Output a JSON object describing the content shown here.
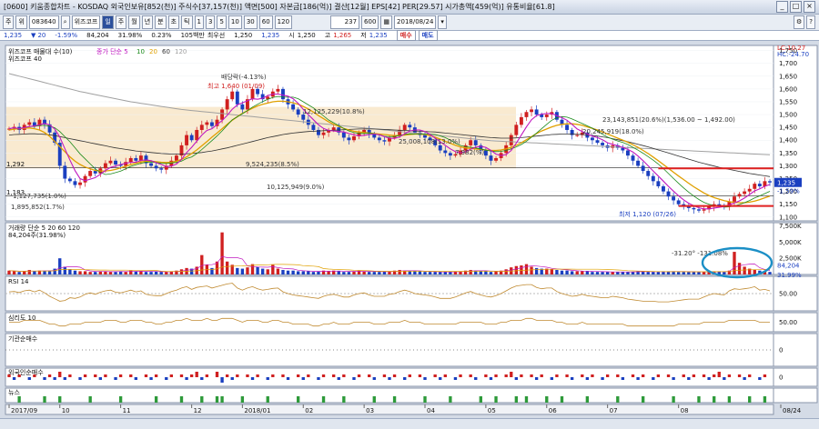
{
  "window": {
    "title": "[0600] 키움종합차트 - KOSDAQ 외국인보유[852(천)] 주식수[37,157(천)] 액면[500] 자본금[186(억)] 결산[12월] EPS[42] PER[29.57] 시가총액[459(억)] 유통비율[61.8]"
  },
  "toolbar": {
    "left_buttons": [
      "주",
      "위"
    ],
    "code_field": "083640",
    "name_field": "위즈코프",
    "period_buttons": [
      "일",
      "주",
      "월",
      "년",
      "분",
      "초",
      "틱"
    ],
    "interval_buttons": [
      "1",
      "3",
      "5",
      "10",
      "30",
      "60",
      "120"
    ],
    "count_field": "237",
    "count_total": "600",
    "date_field": "2018/08/24"
  },
  "quote": {
    "price": "1,235",
    "change": "20",
    "change_rate": "-1.59%",
    "volume": "84,204",
    "volume_ratio": "31.98%",
    "turnover": "0.23%",
    "basis": "105백만",
    "min_label": "최우선",
    "best_bid": "1,250",
    "best_ask": "1,235",
    "open_label": "시",
    "open": "1,250",
    "high_label": "고",
    "high": "1,265",
    "low_label": "저",
    "low": "1,235",
    "buy_button": "매수",
    "sell_button": "매도"
  },
  "chart_data": {
    "type": "line",
    "price_legend": [
      "위즈코프 매물대 수(10)",
      "종가 단순 5",
      "10",
      "20",
      "60",
      "120"
    ],
    "price_header": "위즈코프 40",
    "y_ticks": [
      "1,750",
      "1,700",
      "1,650",
      "1,600",
      "1,550",
      "1,500",
      "1,450",
      "1,400",
      "1,350",
      "1,300",
      "1,250",
      "1,200",
      "1,150",
      "1,100"
    ],
    "ylim": [
      1085,
      1770
    ],
    "lc_label": "LC:10.27",
    "hc_label": "HC:-24.70",
    "last_price_label": "1,235",
    "last_change_label": "-1.59%",
    "ref_lines": [
      {
        "label": "1,292",
        "value": 1292
      },
      {
        "label": "1,183",
        "value": 1183
      }
    ],
    "annotations": [
      "배당락(-4.13%)",
      "최고 1,640 (01/09)",
      "12,125,229(10.8%)",
      "9,524,235(8.5%)",
      "10,125,949(9.0%)",
      "1,127,735(1.0%)",
      "1,895,852(1.7%)",
      "25,008,108(13.0%)",
      "7,982(%)",
      "20,245,919(18.0%)",
      "23,143,851(20.6%)(1,536.00 ~ 1,492.00)",
      "최저 1,120 (07/26)"
    ],
    "volume_legend": "거래량 단순 5 20 60 120",
    "volume_value": "84,204주(31.98%)",
    "volume_annotation": "-31.20° -131.08%",
    "volume_ticks": [
      "7,500K",
      "5,000K",
      "2,500K"
    ],
    "volume_last_label": "84,204",
    "volume_last_pct": "31.99%",
    "rsi_legend": "RSI 14",
    "rsi_tick": "50.00",
    "psy_legend": "심리도 10",
    "psy_tick": "50.00",
    "inst_legend": "기관순매수",
    "inst_tick": "0",
    "foreign_legend": "외국인순매수",
    "foreign_tick": "0",
    "news_legend": "뉴스",
    "x_labels": [
      "2017/09",
      "10",
      "11",
      "12",
      "2018/01",
      "02",
      "03",
      "04",
      "05",
      "06",
      "07",
      "08",
      "08/24"
    ],
    "close": [
      1445,
      1452,
      1440,
      1460,
      1470,
      1455,
      1480,
      1462,
      1430,
      1390,
      1300,
      1250,
      1240,
      1225,
      1235,
      1260,
      1280,
      1270,
      1290,
      1310,
      1320,
      1305,
      1300,
      1315,
      1330,
      1320,
      1340,
      1310,
      1300,
      1290,
      1285,
      1300,
      1320,
      1340,
      1380,
      1420,
      1400,
      1440,
      1460,
      1470,
      1455,
      1480,
      1520,
      1560,
      1590,
      1540,
      1520,
      1560,
      1600,
      1580,
      1560,
      1570,
      1590,
      1600,
      1560,
      1540,
      1520,
      1500,
      1480,
      1460,
      1440,
      1420,
      1430,
      1440,
      1450,
      1430,
      1410,
      1400,
      1415,
      1430,
      1440,
      1425,
      1410,
      1400,
      1395,
      1410,
      1420,
      1440,
      1460,
      1450,
      1430,
      1420,
      1410,
      1400,
      1380,
      1360,
      1350,
      1340,
      1345,
      1360,
      1380,
      1400,
      1380,
      1360,
      1340,
      1320,
      1330,
      1350,
      1380,
      1420,
      1460,
      1490,
      1510,
      1520,
      1500,
      1490,
      1500,
      1510,
      1480,
      1460,
      1440,
      1420,
      1420,
      1430,
      1410,
      1400,
      1390,
      1380,
      1370,
      1380,
      1370,
      1360,
      1340,
      1320,
      1300,
      1280,
      1260,
      1240,
      1220,
      1200,
      1180,
      1165,
      1150,
      1140,
      1135,
      1130,
      1125,
      1130,
      1140,
      1150,
      1145,
      1140,
      1160,
      1180,
      1190,
      1200,
      1210,
      1230,
      1220,
      1240,
      1235
    ],
    "ma20": [
      1440,
      1443,
      1445,
      1447,
      1448,
      1445,
      1440,
      1430,
      1415,
      1395,
      1375,
      1355,
      1335,
      1318,
      1305,
      1295,
      1288,
      1282,
      1280,
      1280,
      1282,
      1286,
      1292,
      1298,
      1305,
      1310,
      1315,
      1318,
      1318,
      1316,
      1314,
      1313,
      1314,
      1318,
      1325,
      1335,
      1348,
      1362,
      1378,
      1395,
      1412,
      1428,
      1445,
      1462,
      1478,
      1492,
      1505,
      1515,
      1525,
      1534,
      1540,
      1545,
      1550,
      1552,
      1552,
      1550,
      1546,
      1540,
      1532,
      1522,
      1510,
      1496,
      1484,
      1472,
      1462,
      1454,
      1446,
      1440,
      1435,
      1432,
      1430,
      1428,
      1426,
      1424,
      1422,
      1420,
      1418,
      1418,
      1420,
      1422,
      1424,
      1424,
      1422,
      1418,
      1412,
      1404,
      1396,
      1388,
      1380,
      1374,
      1370,
      1368,
      1366,
      1364,
      1362,
      1360,
      1360,
      1362,
      1366,
      1372,
      1380,
      1390,
      1402,
      1414,
      1426,
      1436,
      1444,
      1452,
      1458,
      1462,
      1464,
      1464,
      1462,
      1458,
      1452,
      1446,
      1440,
      1432,
      1424,
      1416,
      1408,
      1400,
      1392,
      1382,
      1372,
      1360,
      1348,
      1334,
      1320,
      1305,
      1290,
      1275,
      1260,
      1246,
      1232,
      1218,
      1206,
      1194,
      1184,
      1176,
      1170,
      1164,
      1160,
      1157,
      1156,
      1156,
      1158,
      1162,
      1168,
      1175,
      1182
    ],
    "ma60": [
      1420,
      1422,
      1423,
      1424,
      1425,
      1425,
      1424,
      1423,
      1421,
      1418,
      1414,
      1410,
      1406,
      1402,
      1398,
      1394,
      1390,
      1386,
      1382,
      1378,
      1374,
      1370,
      1367,
      1364,
      1361,
      1358,
      1356,
      1354,
      1352,
      1350,
      1348,
      1347,
      1346,
      1346,
      1346,
      1347,
      1348,
      1350,
      1352,
      1355,
      1358,
      1362,
      1366,
      1370,
      1375,
      1380,
      1385,
      1390,
      1395,
      1400,
      1405,
      1410,
      1414,
      1418,
      1422,
      1425,
      1428,
      1430,
      1432,
      1434,
      1435,
      1436,
      1437,
      1438,
      1439,
      1440,
      1441,
      1442,
      1443,
      1444,
      1444,
      1444,
      1444,
      1443,
      1442,
      1441,
      1440,
      1439,
      1438,
      1437,
      1436,
      1435,
      1434,
      1433,
      1432,
      1430,
      1428,
      1426,
      1424,
      1422,
      1420,
      1418,
      1416,
      1414,
      1412,
      1410,
      1409,
      1408,
      1408,
      1408,
      1409,
      1410,
      1412,
      1414,
      1416,
      1418,
      1420,
      1422,
      1423,
      1424,
      1424,
      1424,
      1423,
      1422,
      1420,
      1418,
      1416,
      1413,
      1410,
      1406,
      1402,
      1398,
      1394,
      1389,
      1384,
      1379,
      1374,
      1368,
      1362,
      1356,
      1350,
      1344,
      1338,
      1332,
      1326,
      1320,
      1314,
      1309,
      1304,
      1299,
      1294,
      1290,
      1286,
      1282,
      1278,
      1274,
      1270,
      1267,
      1264,
      1261,
      1258
    ],
    "ma120": [
      1660,
      1655,
      1650,
      1645,
      1640,
      1635,
      1630,
      1625,
      1620,
      1615,
      1610,
      1605,
      1600,
      1595,
      1590,
      1586,
      1582,
      1578,
      1574,
      1570,
      1566,
      1562,
      1558,
      1554,
      1550,
      1547,
      1544,
      1541,
      1538,
      1535,
      1532,
      1529,
      1526,
      1523,
      1520,
      1518,
      1516,
      1514,
      1512,
      1510,
      1508,
      1506,
      1504,
      1502,
      1500,
      1498,
      1496,
      1494,
      1492,
      1490,
      1488,
      1486,
      1484,
      1482,
      1480,
      1478,
      1476,
      1474,
      1472,
      1470,
      1468,
      1466,
      1464,
      1462,
      1460,
      1458,
      1456,
      1454,
      1452,
      1450,
      1448,
      1446,
      1444,
      1442,
      1440,
      1438,
      1436,
      1434,
      1432,
      1430,
      1428,
      1426,
      1424,
      1422,
      1420,
      1418,
      1416,
      1414,
      1412,
      1410,
      1408,
      1406,
      1404,
      1402,
      1400,
      1398,
      1397,
      1396,
      1395,
      1394,
      1393,
      1392,
      1391,
      1390,
      1389,
      1388,
      1387,
      1386,
      1385,
      1384,
      1383,
      1382,
      1381,
      1380,
      1379,
      1378,
      1377,
      1376,
      1375,
      1374,
      1373,
      1372,
      1371,
      1370,
      1369,
      1368,
      1367,
      1366,
      1365,
      1364,
      1363,
      1362,
      1361,
      1360,
      1359,
      1358,
      1357,
      1356,
      1355,
      1354,
      1353,
      1352,
      1351,
      1350,
      1349,
      1348,
      1347,
      1346,
      1345,
      1344,
      1343
    ],
    "volume": [
      0.6,
      0.5,
      0.4,
      0.5,
      0.7,
      0.5,
      0.6,
      0.5,
      0.6,
      0.9,
      2.5,
      1.2,
      0.8,
      0.6,
      0.5,
      0.5,
      0.4,
      0.4,
      0.5,
      0.5,
      0.4,
      0.4,
      0.5,
      0.4,
      0.6,
      0.5,
      0.5,
      0.4,
      0.4,
      0.5,
      0.4,
      0.4,
      0.5,
      0.6,
      0.8,
      1.0,
      0.9,
      1.2,
      3.0,
      1.5,
      1.0,
      2.0,
      6.5,
      2.0,
      1.5,
      1.0,
      0.9,
      1.1,
      1.6,
      1.2,
      0.9,
      0.8,
      1.5,
      0.9,
      0.7,
      0.6,
      0.6,
      0.5,
      0.5,
      0.5,
      0.4,
      0.5,
      0.6,
      0.5,
      0.6,
      0.5,
      0.4,
      0.4,
      0.5,
      0.6,
      0.5,
      0.4,
      0.4,
      0.4,
      0.5,
      0.5,
      0.6,
      0.7,
      0.6,
      0.5,
      0.5,
      0.5,
      0.4,
      0.4,
      0.4,
      0.4,
      0.4,
      0.4,
      0.5,
      0.5,
      0.6,
      0.7,
      0.6,
      0.5,
      0.5,
      0.4,
      0.5,
      0.6,
      0.8,
      1.1,
      1.3,
      1.4,
      1.6,
      1.2,
      1.0,
      0.9,
      0.9,
      0.8,
      0.7,
      0.6,
      0.6,
      0.5,
      0.5,
      0.5,
      0.5,
      0.4,
      0.4,
      0.4,
      0.4,
      0.4,
      0.4,
      0.4,
      0.4,
      0.4,
      0.5,
      0.5,
      0.4,
      0.4,
      0.4,
      0.5,
      0.5,
      0.5,
      0.4,
      0.4,
      0.4,
      0.4,
      0.4,
      0.4,
      0.4,
      0.5,
      0.5,
      0.4,
      0.6,
      3.5,
      1.8,
      1.2,
      0.9,
      0.7,
      0.6,
      0.5,
      0.4
    ],
    "rsi": [
      55,
      56,
      53,
      58,
      60,
      55,
      60,
      52,
      42,
      35,
      28,
      30,
      38,
      36,
      40,
      48,
      52,
      48,
      54,
      58,
      60,
      54,
      52,
      56,
      60,
      55,
      58,
      48,
      45,
      44,
      44,
      50,
      56,
      60,
      66,
      70,
      62,
      68,
      70,
      72,
      66,
      70,
      74,
      78,
      80,
      66,
      60,
      66,
      70,
      64,
      60,
      62,
      65,
      66,
      55,
      50,
      46,
      44,
      42,
      40,
      38,
      36,
      42,
      46,
      48,
      44,
      40,
      40,
      46,
      50,
      52,
      46,
      42,
      42,
      42,
      48,
      50,
      56,
      60,
      56,
      50,
      48,
      46,
      44,
      40,
      36,
      36,
      36,
      40,
      46,
      52,
      56,
      50,
      46,
      42,
      40,
      44,
      50,
      58,
      66,
      72,
      74,
      76,
      76,
      68,
      64,
      66,
      66,
      56,
      50,
      46,
      42,
      44,
      48,
      44,
      42,
      40,
      38,
      38,
      42,
      40,
      38,
      34,
      32,
      30,
      28,
      28,
      28,
      26,
      26,
      26,
      28,
      30,
      32,
      34,
      34,
      34,
      40,
      46,
      50,
      48,
      46,
      58,
      64,
      62,
      64,
      66,
      70,
      60,
      62,
      58
    ],
    "psy": [
      50,
      50,
      50,
      60,
      60,
      60,
      60,
      50,
      40,
      40,
      30,
      30,
      40,
      40,
      40,
      50,
      50,
      50,
      50,
      60,
      60,
      60,
      50,
      50,
      60,
      60,
      60,
      50,
      50,
      40,
      40,
      50,
      50,
      60,
      60,
      70,
      60,
      60,
      60,
      70,
      60,
      60,
      70,
      70,
      70,
      60,
      50,
      60,
      60,
      60,
      50,
      50,
      60,
      60,
      50,
      50,
      40,
      40,
      40,
      40,
      30,
      30,
      40,
      40,
      50,
      40,
      40,
      40,
      50,
      50,
      50,
      50,
      40,
      40,
      40,
      50,
      50,
      50,
      60,
      50,
      50,
      50,
      40,
      40,
      40,
      40,
      40,
      40,
      40,
      50,
      50,
      50,
      50,
      50,
      40,
      40,
      40,
      50,
      50,
      60,
      60,
      60,
      70,
      70,
      60,
      60,
      60,
      60,
      50,
      50,
      40,
      40,
      40,
      50,
      40,
      40,
      40,
      40,
      40,
      40,
      40,
      40,
      30,
      30,
      30,
      30,
      30,
      30,
      30,
      30,
      30,
      30,
      40,
      40,
      40,
      40,
      40,
      50,
      50,
      50,
      50,
      50,
      60,
      60,
      60,
      60,
      60,
      60,
      50,
      50,
      50
    ],
    "inst": [
      0,
      0,
      0,
      0,
      0,
      0,
      0,
      0,
      0,
      0,
      0,
      0,
      0,
      0,
      0,
      0,
      0,
      0,
      0,
      0,
      0,
      0,
      0,
      0,
      0,
      0,
      0,
      0,
      0,
      0,
      0,
      0,
      0,
      0,
      0,
      0,
      0,
      0,
      0,
      0,
      0,
      0,
      0,
      0,
      0,
      0,
      0,
      0,
      0,
      0,
      0,
      0,
      0,
      0,
      0,
      0,
      0,
      0,
      0,
      0,
      0,
      0,
      0,
      0,
      0,
      0,
      0,
      0,
      0,
      0,
      0,
      0,
      0,
      0,
      0,
      0,
      0,
      0,
      0,
      0,
      0,
      0,
      0,
      0,
      0,
      0,
      0,
      0,
      0,
      0,
      0,
      0,
      0,
      0,
      0,
      0,
      0,
      0,
      0,
      0,
      0,
      0,
      0,
      0,
      0,
      0,
      0,
      0,
      0,
      0,
      0,
      0,
      0,
      0,
      0,
      0,
      0,
      0,
      0,
      0,
      0,
      0,
      0,
      0,
      0,
      0,
      0,
      0,
      0,
      0,
      0,
      0,
      0,
      0,
      0,
      0,
      0,
      0,
      0,
      0,
      0,
      0,
      0,
      0,
      0,
      0,
      0,
      0,
      0,
      0,
      0
    ],
    "foreign": [
      1,
      -1,
      1,
      0,
      -1,
      1,
      0,
      -1,
      1,
      -1,
      2,
      -1,
      1,
      0,
      -1,
      1,
      0,
      1,
      -1,
      1,
      0,
      -1,
      1,
      0,
      1,
      -1,
      0,
      1,
      -1,
      1,
      0,
      -1,
      1,
      0,
      1,
      -1,
      1,
      2,
      -1,
      1,
      0,
      2,
      -2,
      1,
      -1,
      1,
      0,
      1,
      -1,
      1,
      0,
      -1,
      1,
      0,
      1,
      -1,
      0,
      1,
      -1,
      1,
      0,
      -1,
      1,
      0,
      1,
      -1,
      1,
      0,
      -1,
      1,
      0,
      1,
      -1,
      0,
      1,
      -1,
      1,
      0,
      -1,
      1,
      0,
      1,
      -1,
      0,
      1,
      -1,
      1,
      0,
      -1,
      1,
      0,
      1,
      -1,
      0,
      1,
      -1,
      1,
      0,
      1,
      2,
      -1,
      1,
      0,
      1,
      -1,
      1,
      0,
      -1,
      1,
      0,
      1,
      -1,
      0,
      1,
      -1,
      1,
      0,
      -1,
      1,
      0,
      1,
      -1,
      0,
      1,
      -1,
      1,
      0,
      -1,
      1,
      0,
      1,
      -1,
      0,
      1,
      -1,
      1,
      0,
      1,
      -1,
      1,
      2,
      -1,
      1,
      0,
      1,
      -1,
      1,
      0,
      -1,
      1
    ],
    "news": [
      0,
      0,
      1,
      0,
      0,
      0,
      0,
      1,
      0,
      0,
      1,
      0,
      0,
      0,
      0,
      0,
      1,
      0,
      0,
      0,
      0,
      0,
      1,
      0,
      0,
      0,
      0,
      0,
      0,
      1,
      0,
      0,
      0,
      0,
      1,
      0,
      0,
      0,
      1,
      0,
      0,
      1,
      1,
      0,
      0,
      0,
      1,
      0,
      0,
      0,
      0,
      1,
      0,
      0,
      0,
      0,
      0,
      1,
      0,
      0,
      0,
      0,
      1,
      0,
      0,
      0,
      1,
      0,
      0,
      0,
      0,
      0,
      1,
      0,
      0,
      0,
      1,
      0,
      0,
      0,
      0,
      0,
      1,
      0,
      0,
      0,
      0,
      1,
      0,
      0,
      0,
      0,
      0,
      1,
      0,
      0,
      1,
      0,
      0,
      0,
      1,
      0,
      1,
      0,
      0,
      0,
      1,
      0,
      0,
      1,
      0,
      0,
      0,
      0,
      1,
      0,
      0,
      0,
      0,
      0,
      1,
      0,
      0,
      0,
      0,
      1,
      0,
      0,
      0,
      0,
      0,
      1,
      0,
      0,
      0,
      0,
      1,
      0,
      0,
      1,
      0,
      0,
      1,
      0,
      0,
      0,
      1,
      0,
      0,
      1,
      0
    ]
  },
  "colors": {
    "up": "#d02020",
    "down": "#1a3fc0",
    "ma5": "#c018c0",
    "ma10": "#1a8a1a",
    "ma20": "#e0a000",
    "ma60": "#333333",
    "ma120": "#a0a0a0",
    "zone": "#f8e6c8",
    "ellipse": "#1b8fc6",
    "support": "#e02020"
  }
}
